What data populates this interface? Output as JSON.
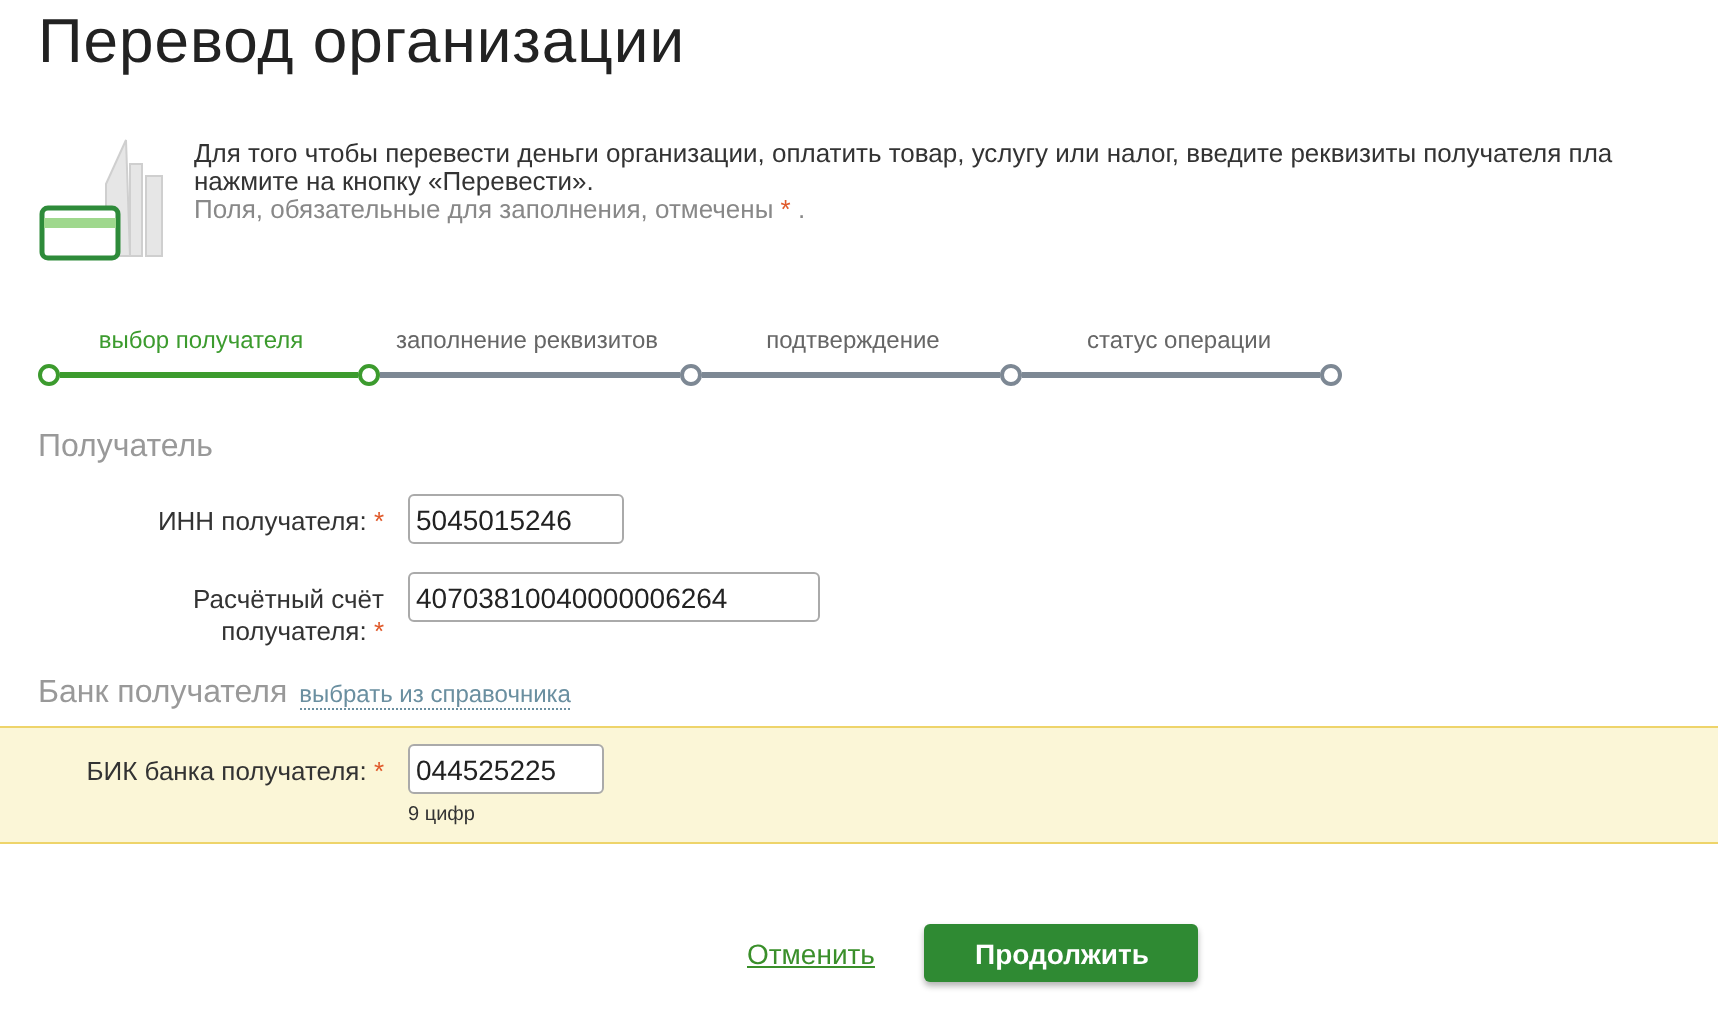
{
  "title": "Перевод организации",
  "intro": {
    "lines": [
      "Для того чтобы перевести деньги организации, оплатить товар, услугу или налог, введите реквизиты получателя пла",
      "нажмите на кнопку «Перевести»."
    ],
    "required_note": "Поля, обязательные для заполнения, отмечены",
    "required_mark": "*",
    "note_end": "."
  },
  "steps": [
    {
      "label": "выбор получателя",
      "selected": true
    },
    {
      "label": "заполнение реквизитов",
      "selected": false
    },
    {
      "label": "подтверждение",
      "selected": false
    },
    {
      "label": "статус операции",
      "selected": false
    }
  ],
  "recipient": {
    "heading": "Получатель",
    "fields": [
      {
        "label": "ИНН получателя:",
        "required": true,
        "value": "5045015246"
      },
      {
        "label": "Расчётный счёт получателя:",
        "required": true,
        "value": "40703810040000006264"
      }
    ]
  },
  "bank": {
    "heading": "Банк получателя",
    "link": "выбрать из справочника",
    "fields": [
      {
        "label": "БИК банка получателя:",
        "required": true,
        "value": "044525225",
        "hint": "9 цифр",
        "highlighted": true
      }
    ]
  },
  "actions": {
    "cancel": "Отменить",
    "continue": "Продолжить"
  }
}
